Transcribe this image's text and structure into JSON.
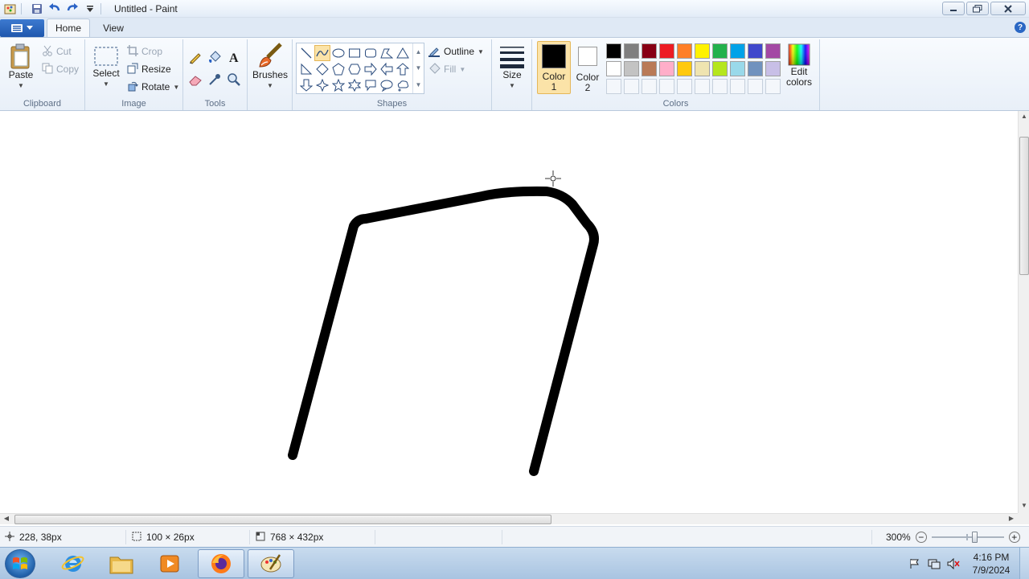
{
  "window": {
    "title": "Untitled - Paint"
  },
  "tabs": {
    "home": "Home",
    "view": "View"
  },
  "ribbon": {
    "clipboard": {
      "label": "Clipboard",
      "paste": "Paste",
      "cut": "Cut",
      "copy": "Copy"
    },
    "image": {
      "label": "Image",
      "select": "Select",
      "crop": "Crop",
      "resize": "Resize",
      "rotate": "Rotate"
    },
    "tools": {
      "label": "Tools"
    },
    "brushes": {
      "label": "Brushes"
    },
    "shapes": {
      "label": "Shapes",
      "outline": "Outline",
      "fill": "Fill",
      "selected_shape": "curve"
    },
    "size": {
      "label": "Size"
    },
    "colors": {
      "label": "Colors",
      "color1_line1": "Color",
      "color1_line2": "1",
      "color2_line1": "Color",
      "color2_line2": "2",
      "edit_line1": "Edit",
      "edit_line2": "colors",
      "color1_value": "#000000",
      "color2_value": "#ffffff",
      "palette_row1": [
        "#000000",
        "#7f7f7f",
        "#880015",
        "#ed1c24",
        "#ff7f27",
        "#fff200",
        "#22b14c",
        "#00a2e8",
        "#3f48cc",
        "#a349a4"
      ],
      "palette_row2": [
        "#ffffff",
        "#c3c3c3",
        "#b97a57",
        "#ffaec9",
        "#ffc90e",
        "#efe4b0",
        "#b5e61d",
        "#99d9ea",
        "#7092be",
        "#c8bfe7"
      ]
    }
  },
  "status": {
    "cursor_position": "228, 38px",
    "selection_size": "100 × 26px",
    "canvas_size": "768 × 432px",
    "zoom": "300%"
  },
  "taskbar": {
    "time": "4:16 PM",
    "date": "7/9/2024"
  }
}
